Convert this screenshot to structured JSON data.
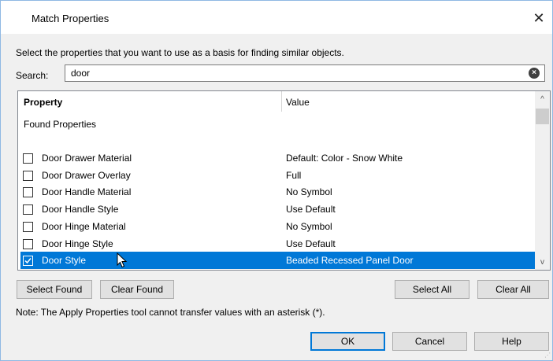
{
  "window": {
    "title": "Match Properties",
    "close_glyph": "✕"
  },
  "instruction": "Select the properties that you want to use as a basis for finding similar objects.",
  "search": {
    "label": "Search:",
    "value": "door"
  },
  "table": {
    "header": {
      "property": "Property",
      "value": "Value"
    },
    "group_label": "Found Properties",
    "rows": [
      {
        "label": "Door Drawer Material",
        "value": "Default: Color - Snow White",
        "checked": false,
        "selected": false
      },
      {
        "label": "Door Drawer Overlay",
        "value": "Full",
        "checked": false,
        "selected": false
      },
      {
        "label": "Door Handle Material",
        "value": "No Symbol",
        "checked": false,
        "selected": false
      },
      {
        "label": "Door Handle Style",
        "value": "Use Default",
        "checked": false,
        "selected": false
      },
      {
        "label": "Door Hinge Material",
        "value": "No Symbol",
        "checked": false,
        "selected": false
      },
      {
        "label": "Door Hinge Style",
        "value": "Use Default",
        "checked": false,
        "selected": false
      },
      {
        "label": "Door Style",
        "value": "Beaded Recessed Panel Door",
        "checked": true,
        "selected": true
      }
    ]
  },
  "buttons": {
    "select_found": "Select Found",
    "clear_found": "Clear Found",
    "select_all": "Select All",
    "clear_all": "Clear All",
    "ok": "OK",
    "cancel": "Cancel",
    "help": "Help"
  },
  "note": "Note: The Apply Properties tool cannot transfer values with an asterisk (*).",
  "colors": {
    "selection": "#0078d7",
    "dialog_bg": "#f0f0f0",
    "border": "#8fb8e3"
  }
}
